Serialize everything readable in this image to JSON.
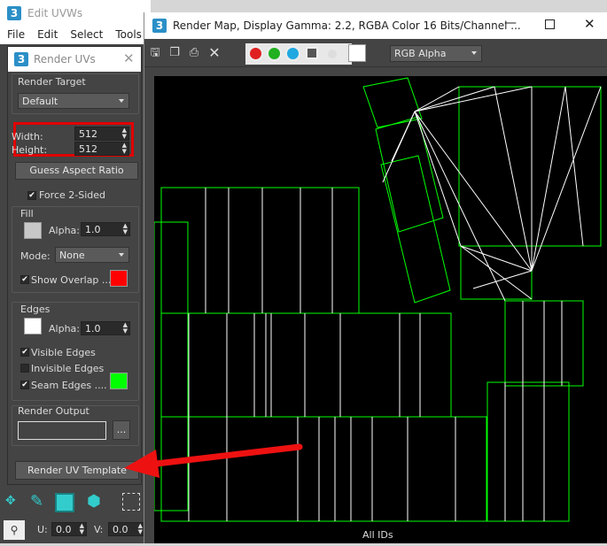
{
  "edit_uvw": {
    "title": "Edit UVWs",
    "menu": [
      "File",
      "Edit",
      "Select",
      "Tools"
    ]
  },
  "render_uvs": {
    "title": "Render UVs",
    "render_target_label": "Render Target",
    "render_target_value": "Default",
    "width_label": "Width:",
    "width_value": "512",
    "height_label": "Height:",
    "height_value": "512",
    "guess_aspect_label": "Guess Aspect Ratio",
    "force_2sided_label": "Force 2-Sided",
    "fill_label": "Fill",
    "fill_alpha_label": "Alpha:",
    "fill_alpha_value": "1.0",
    "mode_label": "Mode:",
    "mode_value": "None",
    "show_overlap_label": "Show Overlap ...",
    "edges_label": "Edges",
    "edges_alpha_label": "Alpha:",
    "edges_alpha_value": "1.0",
    "visible_edges_label": "Visible Edges",
    "invisible_edges_label": "Invisible Edges",
    "seam_edges_label": "Seam Edges ....",
    "render_output_label": "Render Output",
    "browse_label": "...",
    "render_template_label": "Render UV Template"
  },
  "render_map": {
    "title": "Render Map, Display Gamma: 2.2, RGBA Color 16 Bits/Channel ...",
    "channel_value": "RGB Alpha",
    "bottom_value": "All IDs"
  },
  "bottom": {
    "u_label": "U:",
    "u_value": "0.0",
    "v_label": "V:",
    "v_value": "0.0"
  },
  "colors": {
    "fill_color": "#c8c8c8",
    "overlap_color": "#ff0000",
    "edge_color": "#ffffff",
    "seam_color": "#00ff00",
    "highlight_red": "#e00000",
    "accent_blue": "#2b8fc7"
  }
}
